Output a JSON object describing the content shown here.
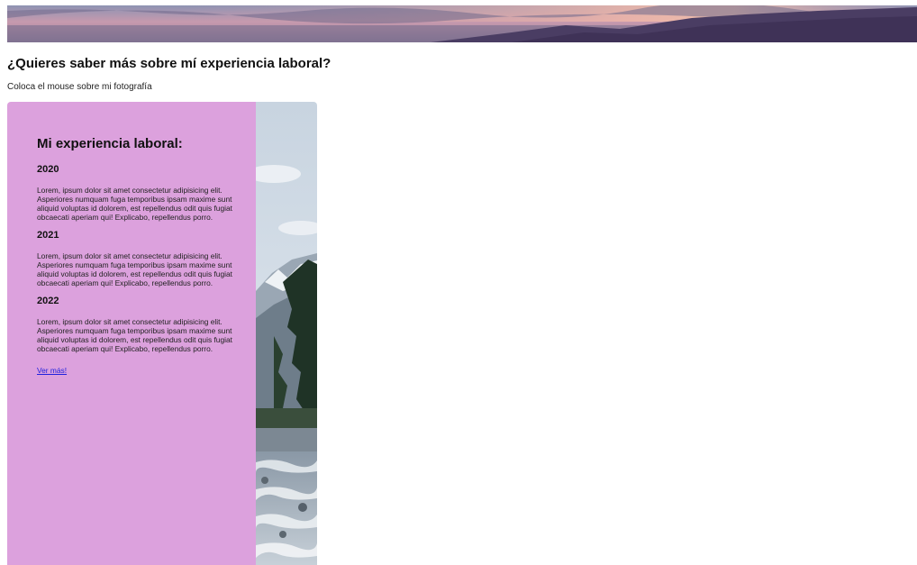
{
  "header": {
    "title": "¿Quieres saber más sobre mí experiencia laboral?",
    "hint": "Coloca el mouse sobre mi fotografía"
  },
  "card": {
    "heading": "Mi experiencia laboral:",
    "entries": [
      {
        "year": "2020",
        "text": "Lorem, ipsum dolor sit amet consectetur adipisicing elit. Asperiores numquam fuga temporibus ipsam maxime sunt aliquid voluptas id dolorem, est repellendus odit quis fugiat obcaecati aperiam qui! Explicabo, repellendus porro."
      },
      {
        "year": "2021",
        "text": "Lorem, ipsum dolor sit amet consectetur adipisicing elit. Asperiores numquam fuga temporibus ipsam maxime sunt aliquid voluptas id dolorem, est repellendus odit quis fugiat obcaecati aperiam qui! Explicabo, repellendus porro."
      },
      {
        "year": "2022",
        "text": "Lorem, ipsum dolor sit amet consectetur adipisicing elit. Asperiores numquam fuga temporibus ipsam maxime sunt aliquid voluptas id dolorem, est repellendus odit quis fugiat obcaecati aperiam qui! Explicabo, repellendus porro."
      }
    ],
    "link_label": "Ver más!"
  },
  "colors": {
    "panel": "#dca1dd",
    "link": "#2222dd"
  }
}
